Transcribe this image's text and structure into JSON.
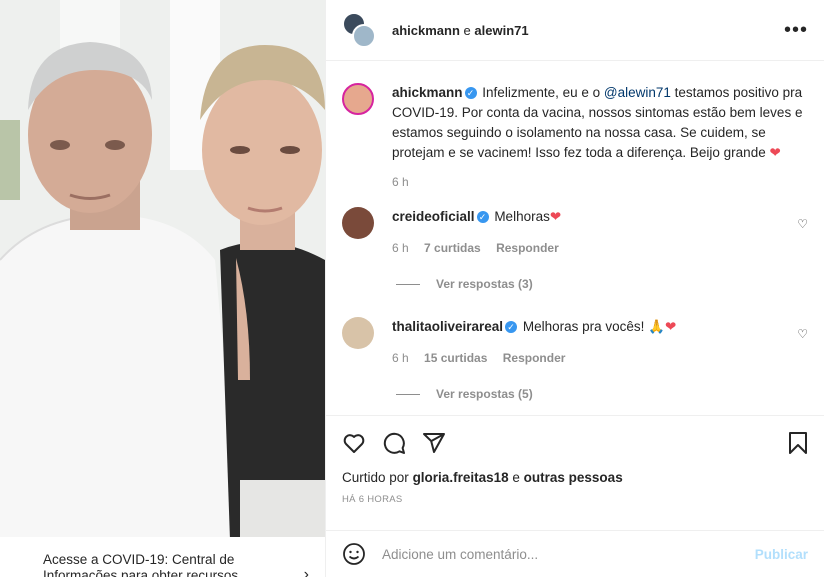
{
  "banner": {
    "text": "Acesse a COVID-19: Central de Informações para obter recursos"
  },
  "header": {
    "user1": "ahickmann",
    "conj": "e",
    "user2": "alewin71",
    "more_icon": "more-horizontal-icon"
  },
  "caption": {
    "username": "ahickmann",
    "text_before": "Infelizmente, eu e o ",
    "mention": "@alewin71",
    "text_after": " testamos positivo pra COVID-19. Por conta da vacina, nossos sintomas estão bem leves e estamos seguindo o isolamento na nossa casa. Se cuidem, se protejam e se vacinem! Isso fez toda a diferença. Beijo grande ",
    "emoji": "❤",
    "time": "6 h"
  },
  "comments": [
    {
      "username": "creideoficiall",
      "text": "Melhoras",
      "emoji": "❤",
      "time": "6 h",
      "likes": "7 curtidas",
      "reply": "Responder",
      "view_replies": "Ver respostas (3)"
    },
    {
      "username": "thalitaoliveirareal",
      "text": "Melhoras pra vocês! ",
      "emoji": "🙏❤",
      "time": "6 h",
      "likes": "15 curtidas",
      "reply": "Responder",
      "view_replies": "Ver respostas (5)"
    }
  ],
  "likes": {
    "prefix": "Curtido por",
    "user": "gloria.freitas18",
    "conj": "e",
    "others": "outras pessoas"
  },
  "post_time": "HÁ 6 HORAS",
  "add_comment": {
    "placeholder": "Adicione um comentário...",
    "post_label": "Publicar"
  },
  "colors": {
    "verified": "#3897f0",
    "heart": "#ed4956",
    "post_disabled": "#b2dffc"
  }
}
